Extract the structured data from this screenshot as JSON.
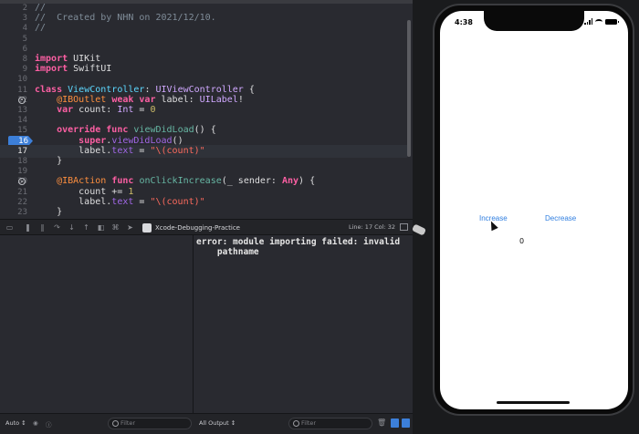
{
  "editor": {
    "lines": [
      {
        "n": "2",
        "html": "<span class=\"c\">//</span>"
      },
      {
        "n": "3",
        "html": "<span class=\"c\">//  Created by NHN on 2021/12/10.</span>"
      },
      {
        "n": "4",
        "html": "<span class=\"c\">//</span>"
      },
      {
        "n": "5",
        "html": ""
      },
      {
        "n": "6",
        "html": ""
      },
      {
        "n": "8",
        "html": "<span class=\"k\">import</span> UIKit"
      },
      {
        "n": "9",
        "html": "<span class=\"k\">import</span> SwiftUI"
      },
      {
        "n": "10",
        "html": ""
      },
      {
        "n": "11",
        "html": "<span class=\"k\">class</span> <span class=\"t\">ViewController</span>: <span class=\"ty\">UIViewController</span> {"
      },
      {
        "n": "12",
        "html": "    <span class=\"a\">@IBOutlet</span> <span class=\"k\">weak var</span> label: <span class=\"ty\">UILabel</span>!",
        "outlet": true
      },
      {
        "n": "13",
        "html": "    <span class=\"k\">var</span> count: <span class=\"ty\">Int</span> = <span class=\"n\">0</span>"
      },
      {
        "n": "14",
        "html": ""
      },
      {
        "n": "15",
        "html": "    <span class=\"k\">override func</span> <span class=\"fn\">viewDidLoad</span>() {"
      },
      {
        "n": "16",
        "html": "        <span class=\"k\">super</span>.<span class=\"v\">viewDidLoad</span>()",
        "breakpoint": true
      },
      {
        "n": "17",
        "html": "        label.<span class=\"v\">text</span> = <span class=\"s\">\"\\(count)\"</span>",
        "current": true
      },
      {
        "n": "18",
        "html": "    }"
      },
      {
        "n": "19",
        "html": ""
      },
      {
        "n": "20",
        "html": "    <span class=\"a\">@IBAction</span> <span class=\"k\">func</span> <span class=\"fn\">onClickIncrease</span>(_ sender: <span class=\"k\">Any</span>) {",
        "outlet": true
      },
      {
        "n": "21",
        "html": "        count += <span class=\"n\">1</span>"
      },
      {
        "n": "22",
        "html": "        label.<span class=\"v\">text</span> = <span class=\"s\">\"\\(count)\"</span>"
      },
      {
        "n": "23",
        "html": "    }"
      }
    ]
  },
  "debug_bar": {
    "scheme_label": "Xcode-Debugging-Practice",
    "line_info": "Line: 17  Col: 32"
  },
  "console": {
    "output": "error: module importing failed: invalid\n    pathname"
  },
  "bottom_bar": {
    "auto_label": "Auto ↕",
    "filter_placeholder_left": "Filter",
    "output_label": "All Output ↕",
    "filter_placeholder_right": "Filter"
  },
  "simulator": {
    "time": "4:38",
    "increase_label": "Increase",
    "decrease_label": "Decrease",
    "count_value": "0"
  },
  "colors": {
    "accent": "#2f7ee0",
    "breakpoint": "#3c7fd9",
    "editor_bg": "#292a30"
  }
}
